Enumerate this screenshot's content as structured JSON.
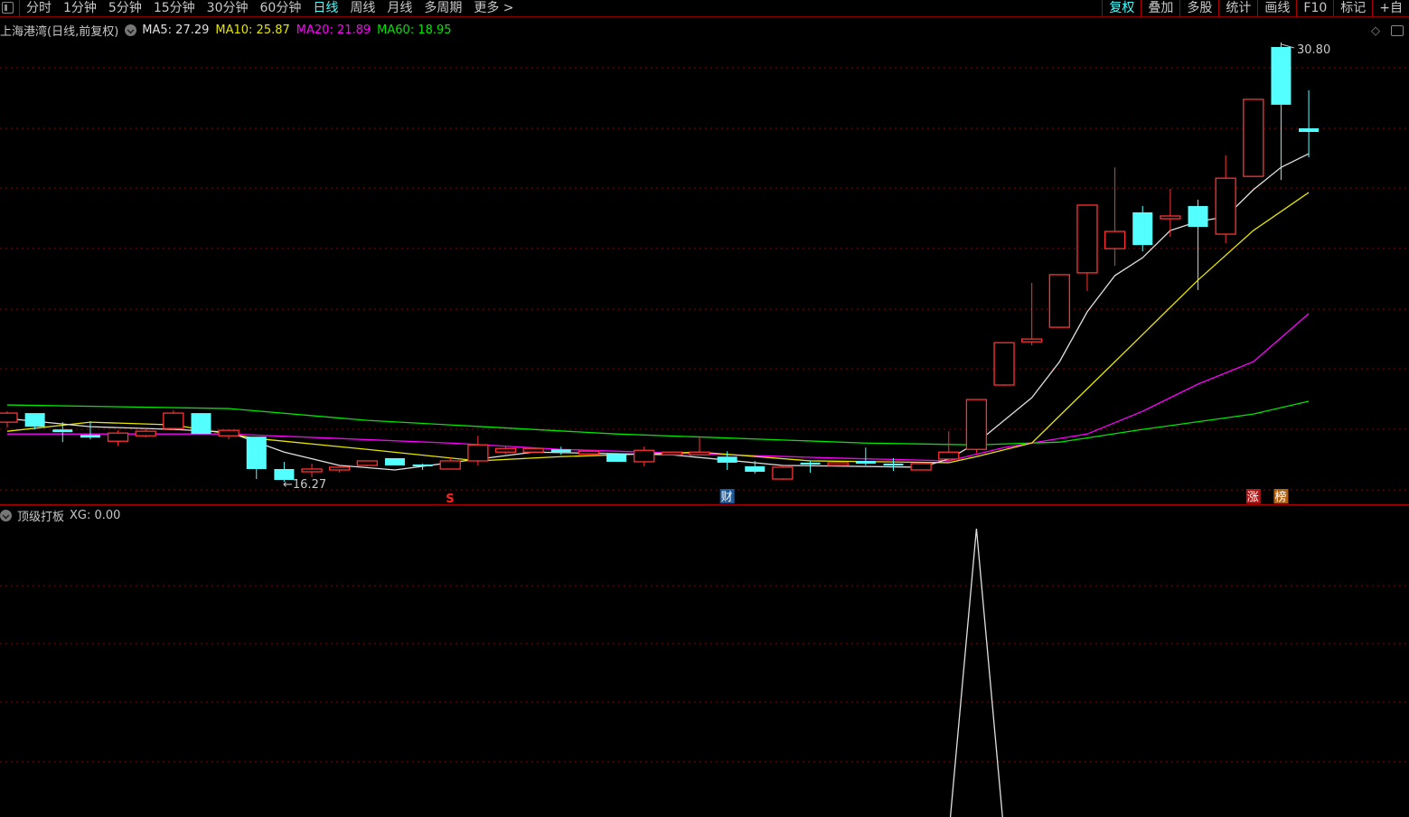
{
  "toolbar": {
    "periods": [
      "分时",
      "1分钟",
      "5分钟",
      "15分钟",
      "30分钟",
      "60分钟",
      "日线",
      "周线",
      "月线",
      "多周期",
      "更多 >"
    ],
    "active_period": "日线",
    "tools": [
      "复权",
      "叠加",
      "多股",
      "统计",
      "画线",
      "F10",
      "标记",
      "+自"
    ],
    "active_tool": "复权"
  },
  "header": {
    "title": "上海港湾(日线,前复权)",
    "ma5": "MA5: 27.29",
    "ma10": "MA10: 25.87",
    "ma20": "MA20: 21.89",
    "ma60": "MA60: 18.95"
  },
  "indicator": {
    "title": "顶级打板",
    "value": "XG: 0.00"
  },
  "colors": {
    "up": "#ff3232",
    "down": "#54ffff",
    "ma5": "#e0e0e0",
    "ma10": "#e6e600",
    "ma20": "#ff00ff",
    "ma60": "#00e600",
    "grid": "#8b0000"
  },
  "chart_data": {
    "type": "candlestick",
    "price_range": [
      16.27,
      30.8
    ],
    "annotations": {
      "high": "30.80",
      "low": "16.27"
    },
    "candles": [
      [
        18.24,
        18.6,
        18.06,
        18.54
      ],
      [
        18.54,
        18.54,
        18.0,
        18.09
      ],
      [
        18.0,
        18.24,
        17.58,
        17.91
      ],
      [
        17.82,
        18.27,
        17.67,
        17.73
      ],
      [
        17.61,
        17.97,
        17.46,
        17.88
      ],
      [
        17.79,
        18.03,
        17.73,
        17.94
      ],
      [
        18.03,
        18.63,
        17.97,
        18.54
      ],
      [
        18.54,
        18.54,
        17.85,
        17.85
      ],
      [
        17.79,
        17.97,
        17.67,
        17.97
      ],
      [
        17.76,
        17.76,
        16.36,
        16.69
      ],
      [
        16.69,
        16.93,
        16.27,
        16.33
      ],
      [
        16.6,
        16.87,
        16.42,
        16.69
      ],
      [
        16.66,
        16.75,
        16.57,
        16.75
      ],
      [
        16.81,
        16.96,
        16.78,
        16.96
      ],
      [
        17.05,
        17.05,
        16.81,
        16.81
      ],
      [
        16.84,
        16.87,
        16.66,
        16.78
      ],
      [
        16.69,
        17.08,
        16.69,
        16.96
      ],
      [
        16.96,
        17.79,
        16.81,
        17.49
      ],
      [
        17.25,
        17.43,
        17.19,
        17.37
      ],
      [
        17.25,
        17.37,
        17.25,
        17.37
      ],
      [
        17.34,
        17.43,
        17.16,
        17.25
      ],
      [
        17.19,
        17.28,
        17.19,
        17.28
      ],
      [
        17.19,
        17.22,
        16.93,
        16.93
      ],
      [
        16.93,
        17.43,
        16.78,
        17.31
      ],
      [
        17.16,
        17.25,
        17.16,
        17.25
      ],
      [
        17.16,
        17.76,
        17.16,
        17.25
      ],
      [
        17.1,
        17.28,
        16.66,
        16.9
      ],
      [
        16.78,
        16.96,
        16.54,
        16.6
      ],
      [
        16.36,
        16.78,
        16.33,
        16.75
      ],
      [
        16.9,
        16.96,
        16.57,
        16.84
      ],
      [
        16.81,
        16.9,
        16.81,
        16.9
      ],
      [
        16.96,
        17.4,
        16.81,
        16.87
      ],
      [
        16.87,
        17.05,
        16.63,
        16.81
      ],
      [
        16.66,
        16.87,
        16.66,
        16.87
      ],
      [
        17.02,
        17.94,
        16.9,
        17.25
      ],
      [
        17.34,
        18.99,
        17.22,
        18.99
      ],
      [
        19.47,
        20.87,
        19.44,
        20.87
      ],
      [
        20.9,
        22.85,
        20.78,
        20.99
      ],
      [
        21.38,
        23.12,
        21.38,
        23.12
      ],
      [
        23.18,
        25.42,
        22.58,
        25.42
      ],
      [
        23.98,
        26.67,
        23.41,
        24.55
      ],
      [
        25.18,
        25.39,
        23.89,
        24.1
      ],
      [
        24.97,
        25.96,
        24.37,
        25.06
      ],
      [
        25.39,
        25.6,
        22.61,
        24.7
      ],
      [
        24.46,
        27.06,
        24.16,
        26.31
      ],
      [
        26.37,
        28.92,
        26.37,
        28.92
      ],
      [
        30.65,
        30.8,
        26.25,
        28.74
      ],
      [
        27.96,
        29.22,
        27.0,
        27.84
      ]
    ],
    "ma": {
      "ma5": [
        [
          0,
          18.36
        ],
        [
          3,
          18.09
        ],
        [
          6,
          18.0
        ],
        [
          8,
          17.91
        ],
        [
          10,
          17.25
        ],
        [
          12,
          16.81
        ],
        [
          14,
          16.66
        ],
        [
          16,
          16.9
        ],
        [
          19,
          17.25
        ],
        [
          24,
          17.16
        ],
        [
          28,
          16.81
        ],
        [
          33,
          16.75
        ],
        [
          34,
          17.02
        ],
        [
          35,
          17.55
        ],
        [
          36,
          18.3
        ],
        [
          37,
          19.05
        ],
        [
          38,
          20.24
        ],
        [
          39,
          21.89
        ],
        [
          40,
          23.09
        ],
        [
          41,
          23.68
        ],
        [
          42,
          24.58
        ],
        [
          43,
          24.88
        ],
        [
          44,
          25.03
        ],
        [
          45,
          25.93
        ],
        [
          46,
          26.67
        ],
        [
          47,
          27.12
        ]
      ],
      "ma10": [
        [
          0,
          17.94
        ],
        [
          3,
          18.24
        ],
        [
          6,
          18.15
        ],
        [
          9,
          17.7
        ],
        [
          13,
          17.34
        ],
        [
          17,
          16.96
        ],
        [
          20,
          17.1
        ],
        [
          25,
          17.25
        ],
        [
          29,
          16.96
        ],
        [
          34,
          16.9
        ],
        [
          35,
          17.1
        ],
        [
          37,
          17.55
        ],
        [
          38,
          18.45
        ],
        [
          40,
          20.24
        ],
        [
          43,
          22.94
        ],
        [
          45,
          24.58
        ],
        [
          47,
          25.84
        ]
      ],
      "ma20": [
        [
          0,
          17.85
        ],
        [
          8,
          17.85
        ],
        [
          16,
          17.55
        ],
        [
          20,
          17.34
        ],
        [
          25,
          17.19
        ],
        [
          30,
          17.05
        ],
        [
          34,
          16.96
        ],
        [
          36,
          17.4
        ],
        [
          39,
          17.85
        ],
        [
          41,
          18.6
        ],
        [
          43,
          19.5
        ],
        [
          45,
          20.24
        ],
        [
          47,
          21.83
        ]
      ],
      "ma60": [
        [
          0,
          18.81
        ],
        [
          8,
          18.69
        ],
        [
          13,
          18.3
        ],
        [
          22,
          17.85
        ],
        [
          31,
          17.55
        ],
        [
          35,
          17.49
        ],
        [
          38,
          17.58
        ],
        [
          41,
          18.0
        ],
        [
          45,
          18.51
        ],
        [
          47,
          18.93
        ]
      ]
    },
    "xg": {
      "signal_index": 35,
      "values_range": [
        0,
        1
      ]
    },
    "markers": [
      {
        "index": 16,
        "text": "S",
        "color": "#ff2020"
      },
      {
        "index": 26,
        "text": "财",
        "color": "#1e5a9a"
      },
      {
        "index": 45,
        "text": "涨",
        "color": "#b01818"
      },
      {
        "index": 46,
        "text": "榜",
        "color": "#b06010"
      }
    ]
  }
}
